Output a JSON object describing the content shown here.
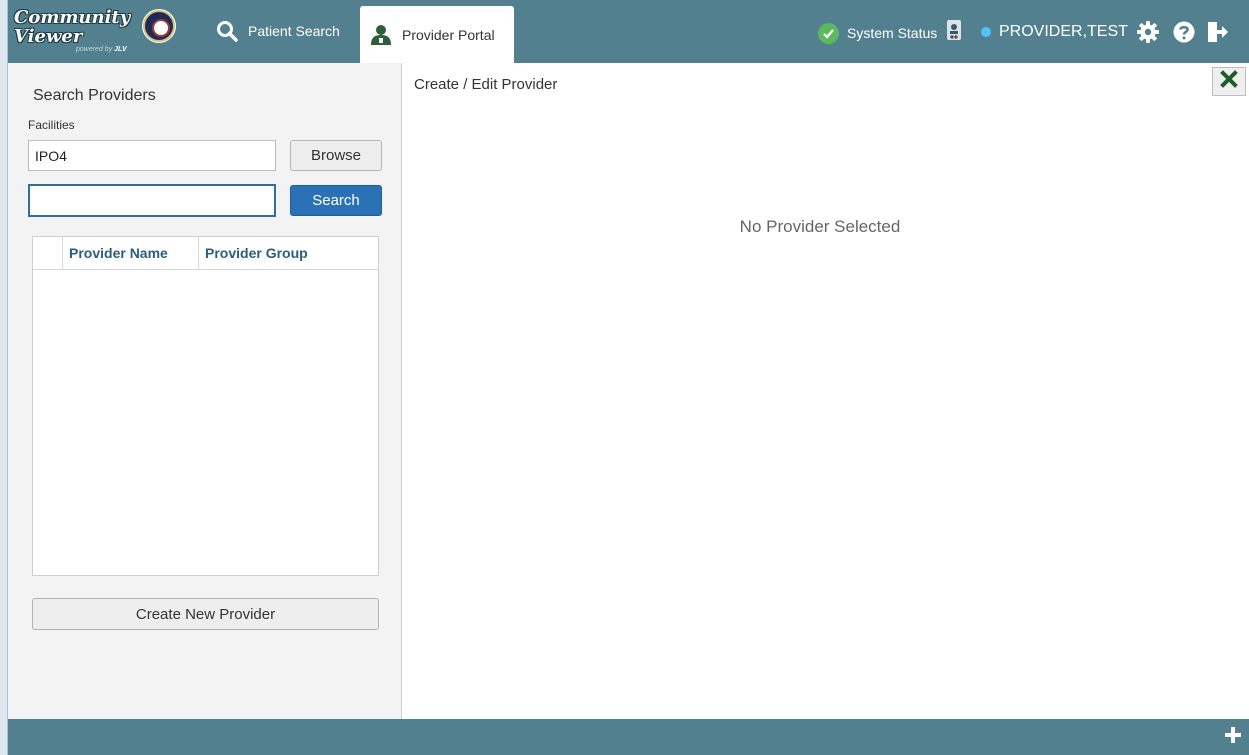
{
  "header": {
    "logo_line1": "Community",
    "logo_line2": "Viewer",
    "logo_tag_prefix": "powered by",
    "logo_tag_brand": "JLV",
    "nav": [
      {
        "label": "Patient Search",
        "icon": "search-icon"
      },
      {
        "label": "Provider Portal",
        "icon": "provider-icon",
        "active": true
      }
    ],
    "system_status": "System Status",
    "user_name": "PROVIDER,TEST",
    "icons": [
      "system-status-icon",
      "user-badge-icon",
      "settings-gear-icon",
      "help-icon",
      "logout-icon"
    ],
    "colors": {
      "bar": "#52808e",
      "status_ok": "#5cb85c",
      "online_dot": "#4fc3f7"
    }
  },
  "search_panel": {
    "title": "Search Providers",
    "facilities_label": "Facilities",
    "facilities_value": "IPO4",
    "browse_label": "Browse",
    "search_value": "",
    "search_label": "Search",
    "columns": [
      "Provider Name",
      "Provider Group"
    ],
    "rows": [],
    "create_label": "Create New Provider",
    "colors": {
      "primary_button": "#2a72b5",
      "column_header": "#2a5e82"
    }
  },
  "edit_panel": {
    "title": "Create / Edit Provider",
    "empty_message": "No Provider Selected",
    "close_icon": "close-x-icon"
  },
  "footer": {
    "add_icon": "plus-icon"
  }
}
